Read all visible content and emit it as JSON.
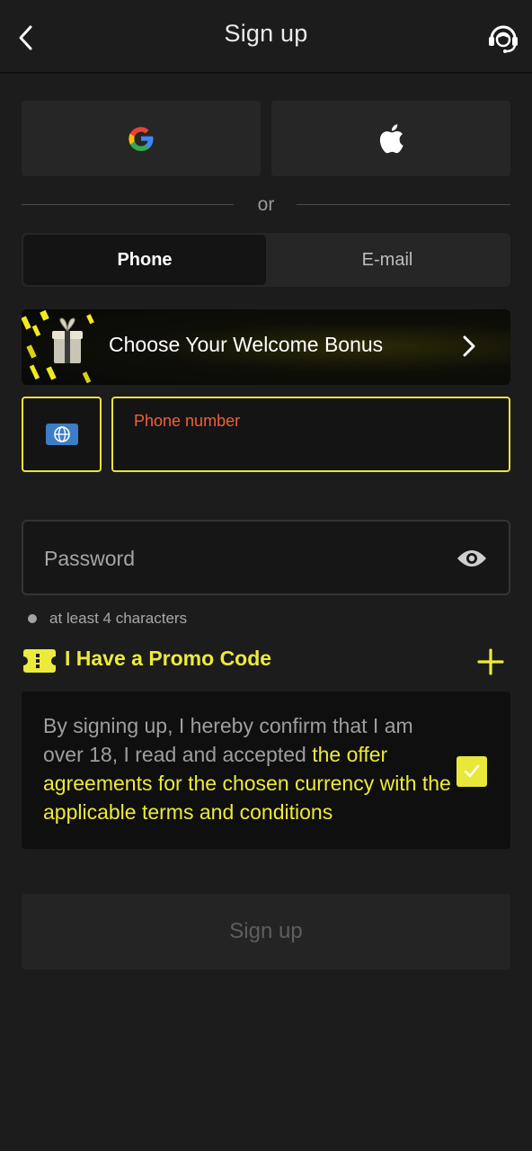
{
  "header": {
    "title": "Sign up",
    "back_icon": "chevron-left-icon",
    "support_icon": "headset-icon"
  },
  "social": {
    "google_icon": "google-icon",
    "apple_icon": "apple-icon"
  },
  "divider": {
    "text": "or"
  },
  "tabs": [
    {
      "label": "Phone",
      "active": true
    },
    {
      "label": "E-mail",
      "active": false
    }
  ],
  "bonus": {
    "label": "Choose Your Welcome Bonus",
    "icon": "gift-icon",
    "arrow_icon": "chevron-right-icon"
  },
  "phone": {
    "country_icon": "globe-icon",
    "label": "Phone number",
    "value": ""
  },
  "password": {
    "placeholder": "Password",
    "toggle_icon": "eye-icon",
    "hint": "at least 4 characters"
  },
  "promo": {
    "label": "I Have a Promo Code",
    "icon": "ticket-icon",
    "add_icon": "plus-icon"
  },
  "agreement": {
    "text_plain": "By signing up, I hereby confirm that I am over 18, I read and accepted ",
    "text_link": "the offer agreements for the chosen currency with the applicable terms and conditions",
    "checked": true
  },
  "submit": {
    "label": "Sign up"
  },
  "colors": {
    "accent": "#e9e83a",
    "background": "#1c1c1c",
    "error": "#f0603a",
    "globe": "#3d7dc8"
  }
}
